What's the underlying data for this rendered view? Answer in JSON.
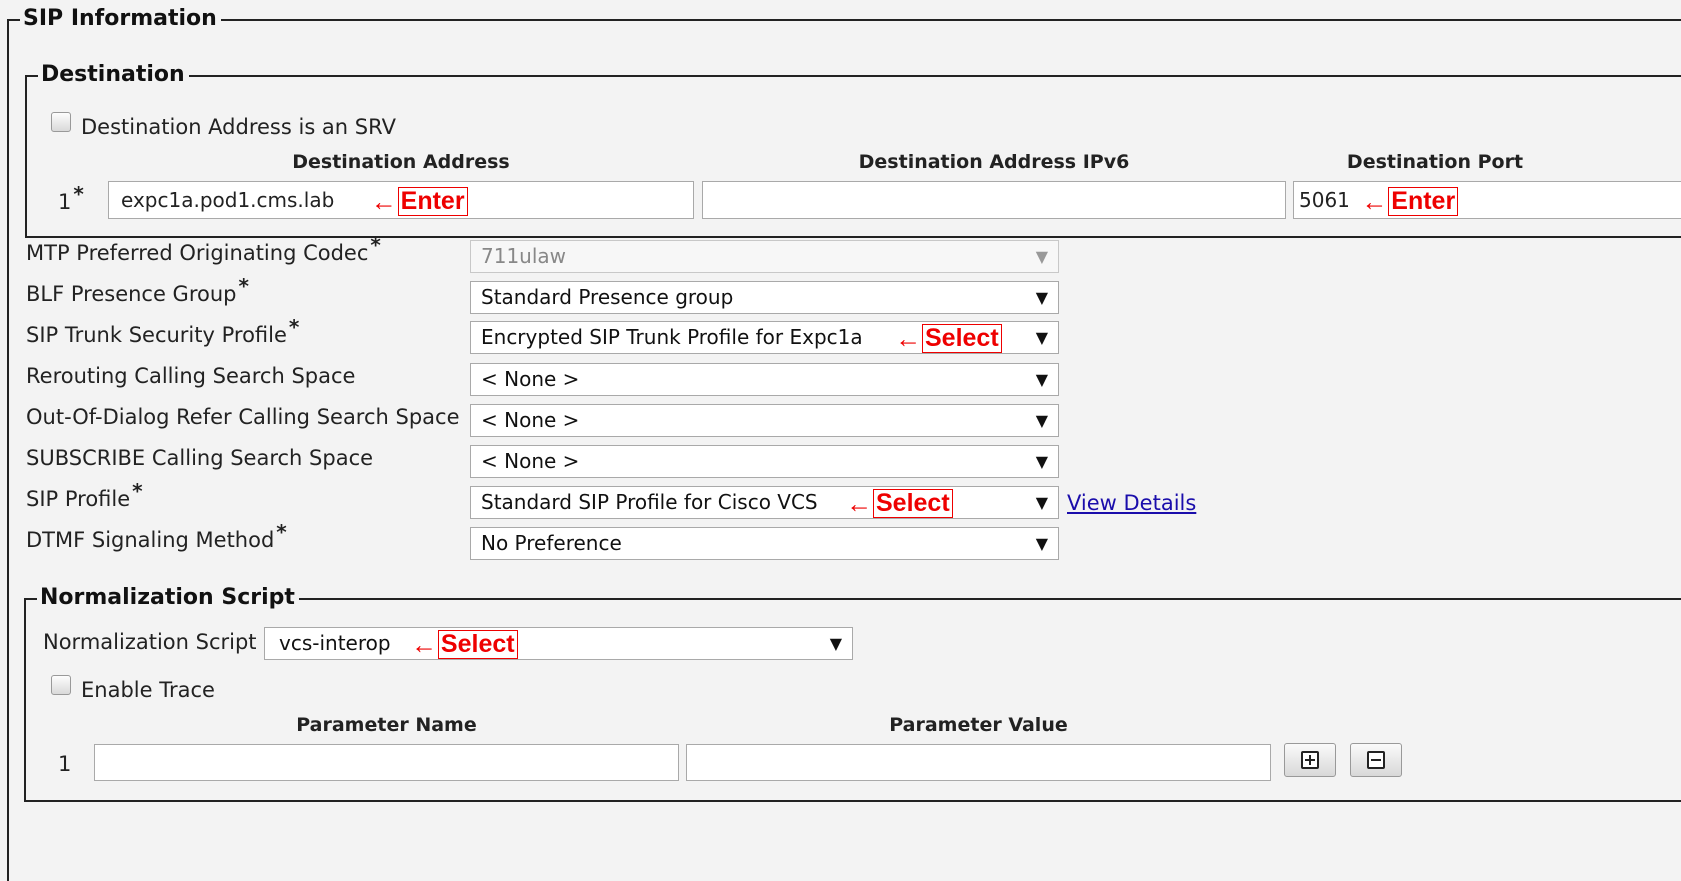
{
  "sip_information": {
    "legend": "SIP Information",
    "destination": {
      "legend": "Destination",
      "srv_checkbox_label": "Destination Address is an SRV",
      "headers": {
        "address": "Destination Address",
        "address_ipv6": "Destination Address IPv6",
        "port": "Destination Port"
      },
      "rows": [
        {
          "index": "1",
          "required": "*",
          "address": "expc1a.pod1.cms.lab",
          "address_ipv6": "",
          "port": "5061"
        }
      ]
    },
    "fields": [
      {
        "label": "MTP Preferred Originating Codec",
        "required": "*",
        "value": "711ulaw",
        "disabled": true
      },
      {
        "label": "BLF Presence Group",
        "required": "*",
        "value": "Standard Presence group"
      },
      {
        "label": "SIP Trunk Security Profile",
        "required": "*",
        "value": "Encrypted SIP Trunk Profile for Expc1a"
      },
      {
        "label": "Rerouting Calling Search Space",
        "required": "",
        "value": "< None >"
      },
      {
        "label": "Out-Of-Dialog Refer Calling Search Space",
        "required": "",
        "value": "< None >"
      },
      {
        "label": "SUBSCRIBE Calling Search Space",
        "required": "",
        "value": "< None >"
      },
      {
        "label": "SIP Profile",
        "required": "*",
        "value": "Standard SIP Profile for Cisco VCS"
      },
      {
        "label": "DTMF Signaling Method",
        "required": "*",
        "value": "No Preference"
      }
    ],
    "view_details_link": "View Details",
    "normalization": {
      "legend": "Normalization Script",
      "script_label": "Normalization Script",
      "script_value": "vcs-interop",
      "enable_trace_label": "Enable Trace",
      "headers": {
        "name": "Parameter Name",
        "value": "Parameter Value"
      },
      "rows": [
        {
          "index": "1",
          "name": "",
          "value": ""
        }
      ]
    }
  },
  "annotations": {
    "arrow": "←",
    "enter": "Enter",
    "select": "Select"
  },
  "icons": {
    "dropdown": "chevron-down-icon",
    "add": "plus-icon",
    "remove": "minus-icon"
  },
  "colors": {
    "annotation": "#e00000",
    "link": "#1a0dab",
    "background": "#f3f3f3"
  }
}
